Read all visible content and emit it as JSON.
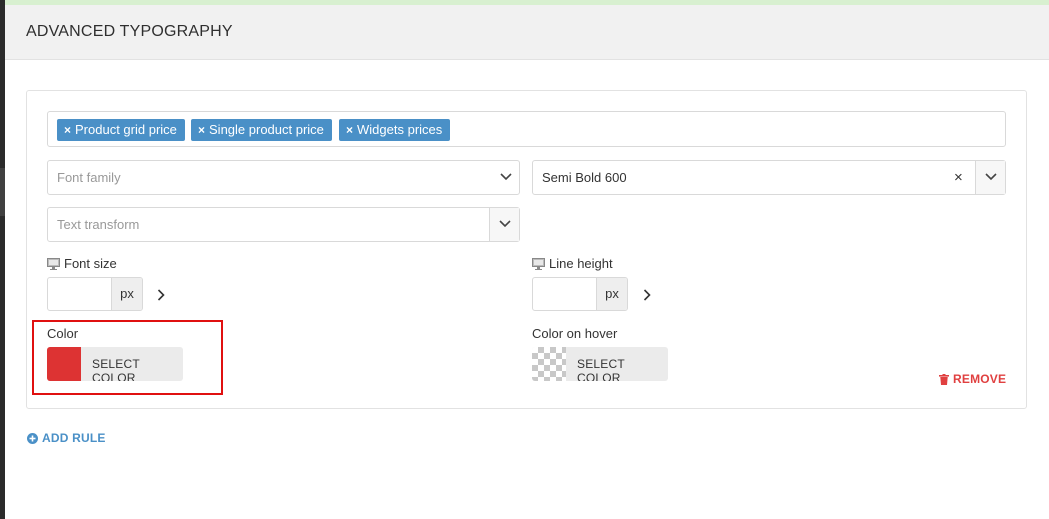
{
  "panel": {
    "title": "ADVANCED TYPOGRAPHY"
  },
  "selectors": {
    "tags": [
      {
        "remove": "×",
        "label": "Product grid price"
      },
      {
        "remove": "×",
        "label": "Single product price"
      },
      {
        "remove": "×",
        "label": "Widgets prices"
      }
    ]
  },
  "font_family": {
    "placeholder": "Font family",
    "icon": "chevron-down-icon"
  },
  "font_weight": {
    "value": "Semi Bold 600",
    "clear": "×",
    "icon": "chevron-down-icon"
  },
  "text_transform": {
    "placeholder": "Text transform",
    "icon": "chevron-down-icon"
  },
  "font_size": {
    "label": "Font size",
    "value": "",
    "unit": "px",
    "device_icon": "monitor-icon"
  },
  "line_height": {
    "label": "Line height",
    "value": "",
    "unit": "px",
    "device_icon": "monitor-icon"
  },
  "color": {
    "label": "Color",
    "swatch": "#dd3333",
    "button": "SELECT COLOR"
  },
  "color_hover": {
    "label": "Color on hover",
    "swatch": "transparent",
    "button": "SELECT COLOR"
  },
  "actions": {
    "remove": "REMOVE",
    "add_rule": "ADD RULE"
  },
  "colors": {
    "accent": "#4a90c7",
    "danger": "#e04040",
    "highlight": "#e01010"
  }
}
